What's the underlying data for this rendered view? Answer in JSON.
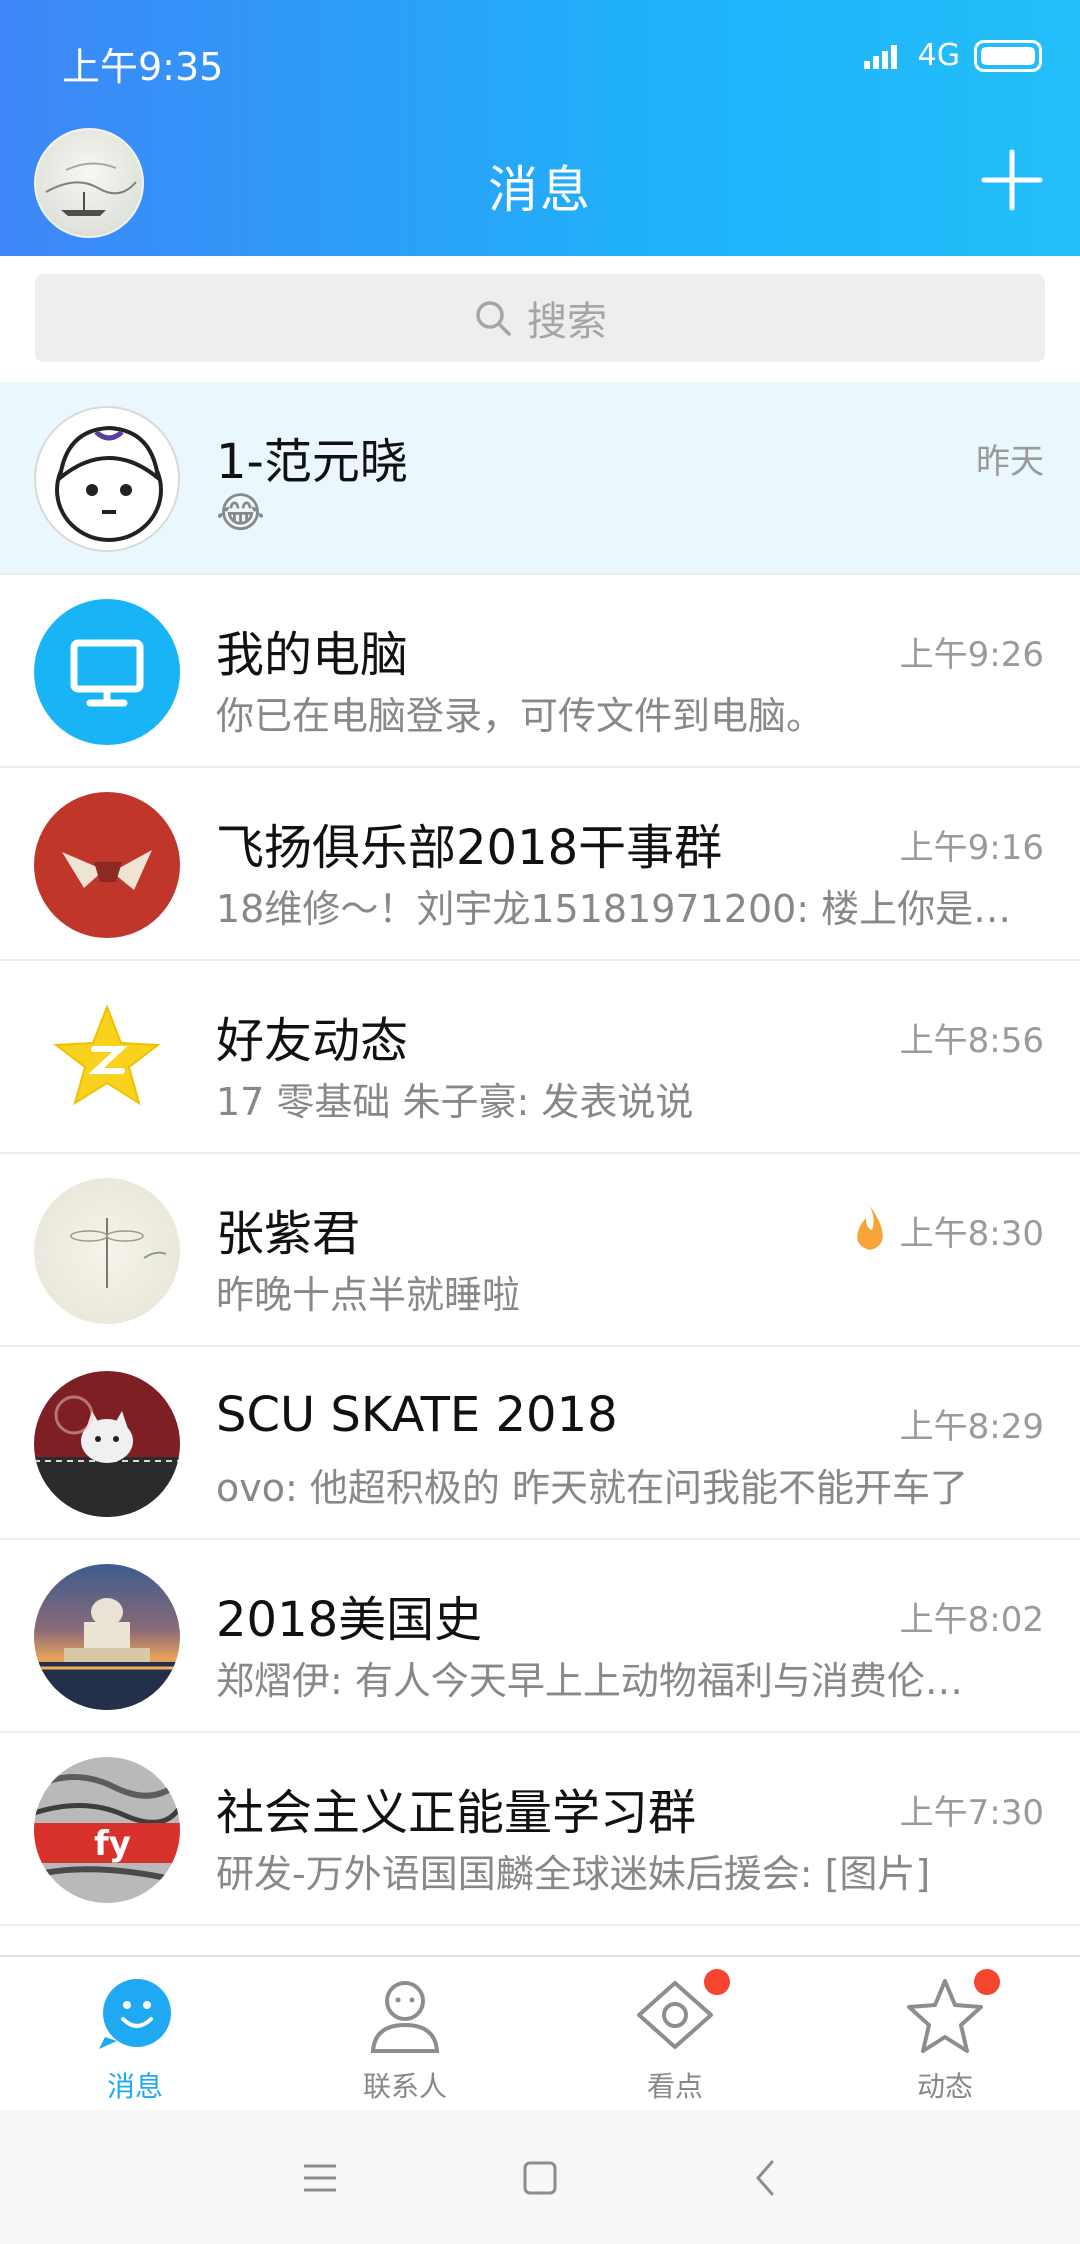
{
  "status_bar": {
    "time": "上午9:35",
    "network": "4G"
  },
  "header": {
    "title": "消息"
  },
  "search": {
    "placeholder": "搜索"
  },
  "conversations": [
    {
      "name": "1-范元晓",
      "message": "😂",
      "time": "昨天",
      "pinned": true,
      "avatar": "cartoon-face"
    },
    {
      "name": "我的电脑",
      "message": "你已在电脑登录，可传文件到电脑。",
      "time": "上午9:26",
      "avatar": "monitor-icon"
    },
    {
      "name": "飞扬俱乐部2018干事群",
      "message": "18维修～！刘宇龙15181971200: 楼上你是…",
      "time": "上午9:16",
      "avatar": "red-group-logo"
    },
    {
      "name": "好友动态",
      "message": "17 零基础 朱子豪: 发表说说",
      "time": "上午8:56",
      "avatar": "star-icon"
    },
    {
      "name": "张紫君",
      "message": "昨晚十点半就睡啦",
      "time": "上午8:30",
      "avatar": "dragonfly-photo",
      "badge": "fire-icon"
    },
    {
      "name": "SCU SKATE 2018",
      "message": "ovo: 他超积极的 昨天就在问我能不能开车了",
      "time": "上午8:29",
      "avatar": "cat-photo"
    },
    {
      "name": "2018美国史",
      "message": "郑熠伊: 有人今天早上上动物福利与消费伦…",
      "time": "上午8:02",
      "avatar": "cathedral-photo"
    },
    {
      "name": "社会主义正能量学习群",
      "message": "研发-万外语国国麟全球迷妹后援会: [图片]",
      "time": "上午7:30",
      "avatar": "graffiti-photo"
    }
  ],
  "tabs": [
    {
      "label": "消息",
      "active": true,
      "icon": "smile-bubble-icon"
    },
    {
      "label": "联系人",
      "active": false,
      "icon": "person-icon"
    },
    {
      "label": "看点",
      "active": false,
      "icon": "eye-icon",
      "dot": true
    },
    {
      "label": "动态",
      "active": false,
      "icon": "star-outline-icon",
      "dot": true
    }
  ],
  "colors": {
    "header_start": "#3e86f7",
    "header_end": "#23bffb",
    "accent": "#1fa9f3",
    "pinned_bg": "#eaf7fd",
    "dot": "#f5452f"
  }
}
